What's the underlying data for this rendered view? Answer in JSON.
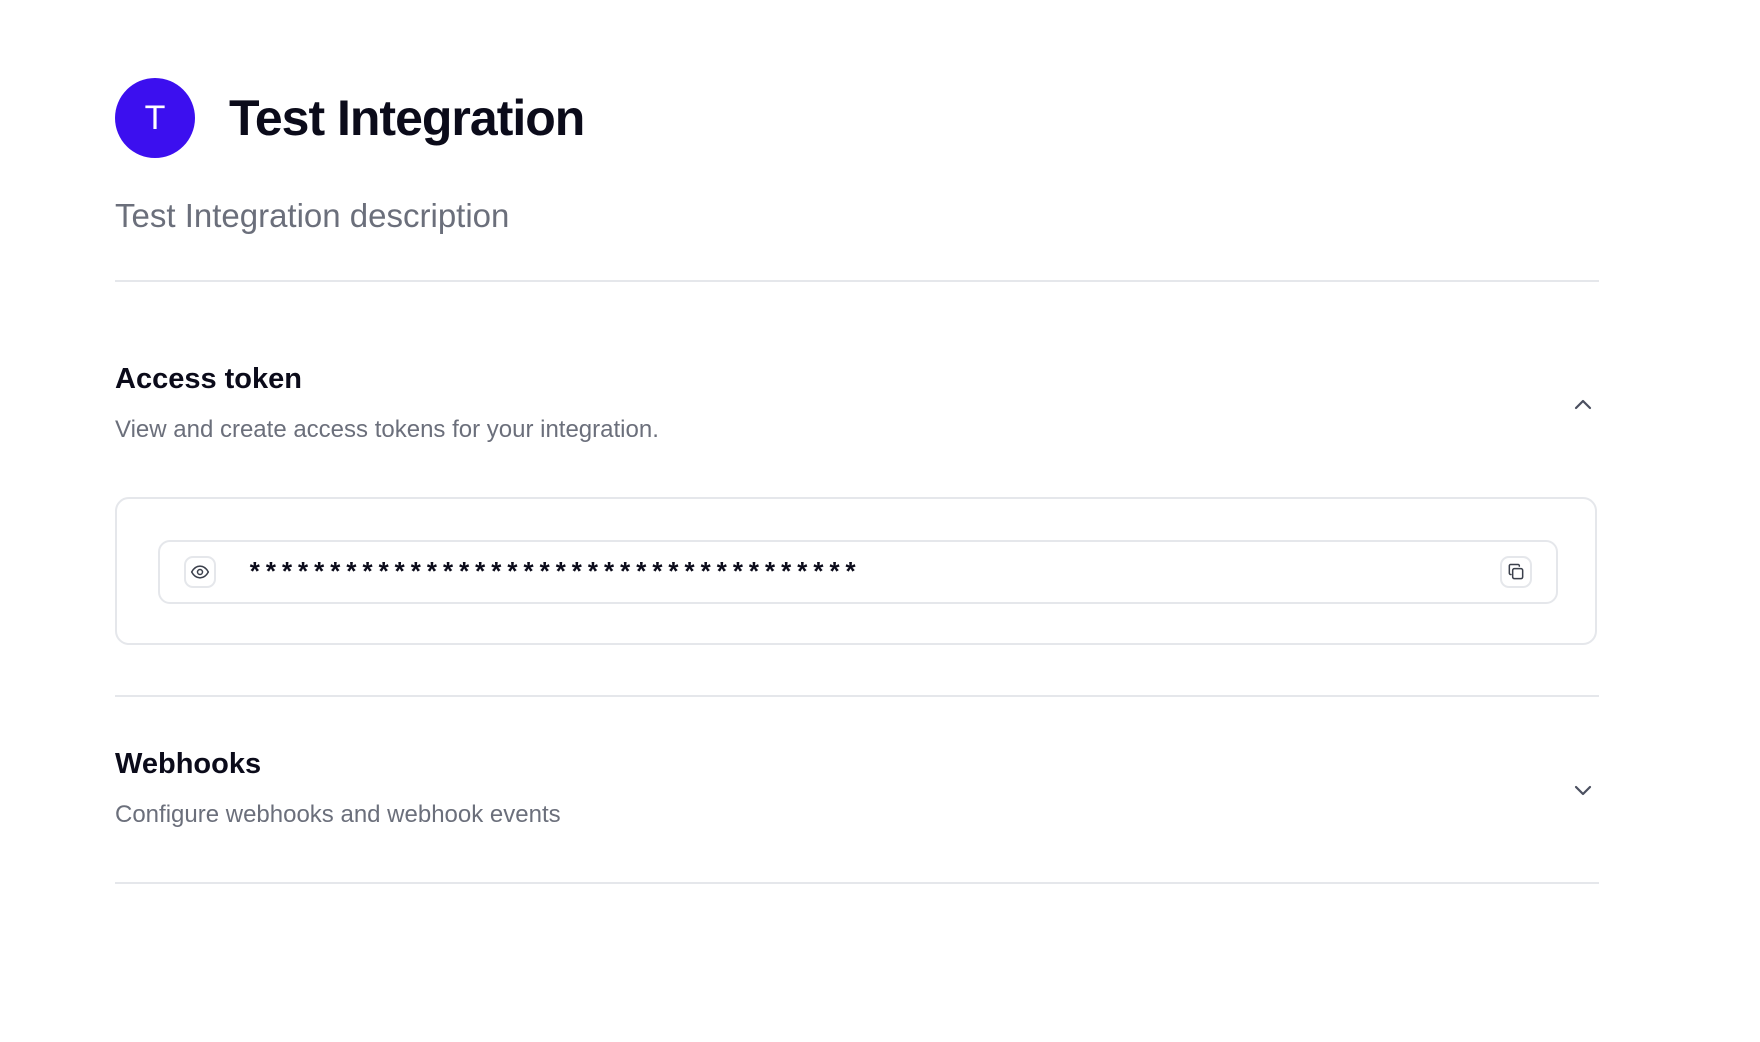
{
  "integration": {
    "avatar_letter": "T",
    "title": "Test Integration",
    "description": "Test Integration description",
    "avatar_color": "#3c0fef"
  },
  "access_token": {
    "title": "Access token",
    "description": "View and create access tokens for your integration.",
    "expanded": true,
    "token_masked": "**************************************",
    "icons": {
      "toggle_visibility": "eye-icon",
      "copy": "copy-icon",
      "collapse": "chevron-up-icon"
    }
  },
  "webhooks": {
    "title": "Webhooks",
    "description": "Configure webhooks and webhook events",
    "expanded": false,
    "icons": {
      "expand": "chevron-down-icon"
    }
  },
  "colors": {
    "text_primary": "#0b0b1a",
    "text_secondary": "#6b6f7b",
    "border": "#e5e7eb",
    "accent": "#3c0fef"
  }
}
